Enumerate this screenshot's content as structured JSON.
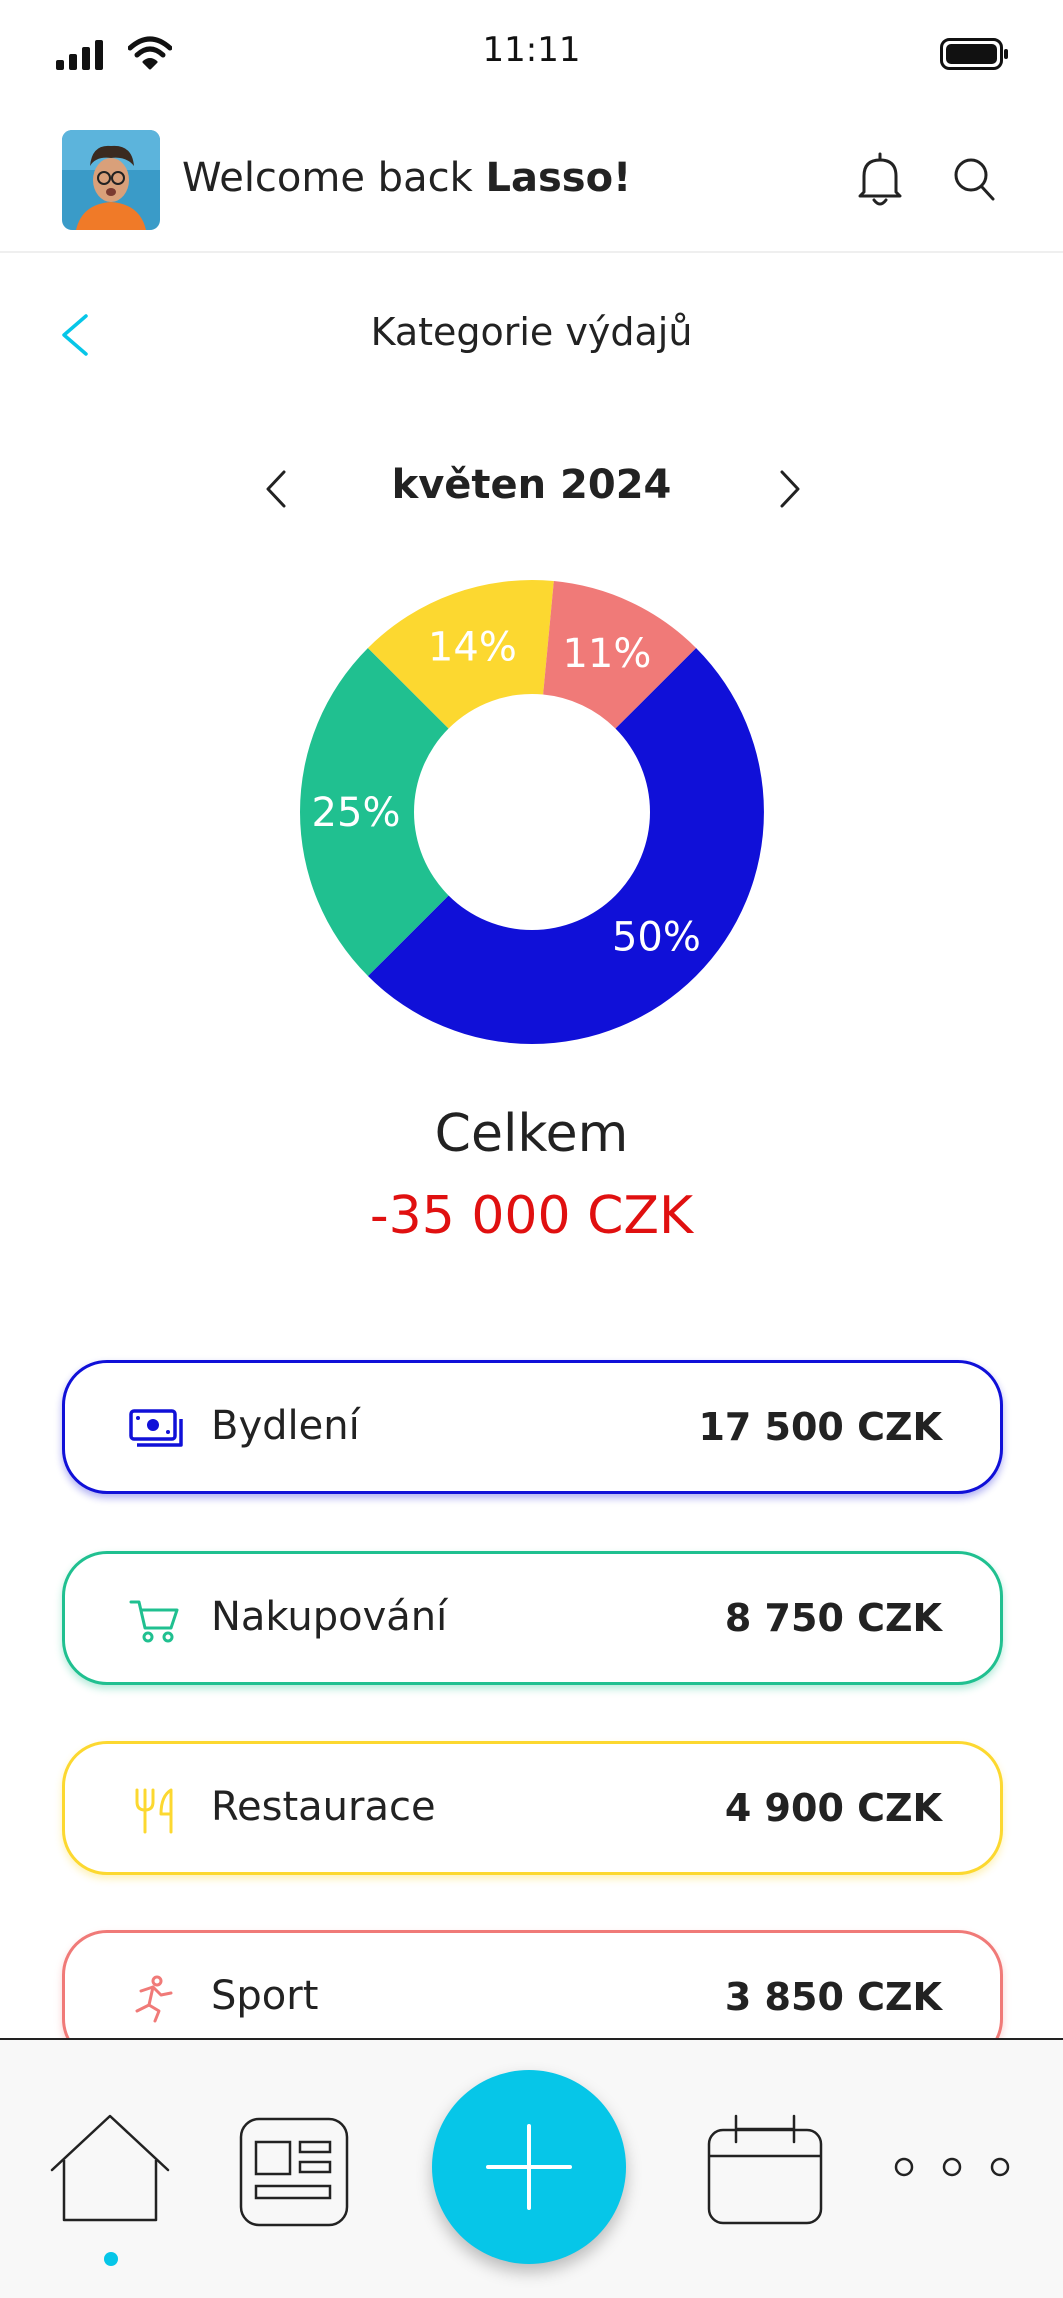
{
  "status_bar": {
    "time": "11:11"
  },
  "header": {
    "welcome_prefix": "Welcome back ",
    "user_name": "Lasso!",
    "icons": [
      "bell-icon",
      "search-icon"
    ]
  },
  "page": {
    "title": "Kategorie výdajů",
    "month": "květen 2024"
  },
  "chart_data": {
    "type": "pie",
    "categories": [
      "Bydlení",
      "Nakupování",
      "Restaurace",
      "Sport"
    ],
    "values": [
      50,
      25,
      14,
      11
    ],
    "labels": [
      "50%",
      "25%",
      "14%",
      "11%"
    ],
    "colors": [
      "#1010d8",
      "#20c090",
      "#fcd830",
      "#f07a78"
    ]
  },
  "total": {
    "label": "Celkem",
    "value": "-35 000 CZK"
  },
  "categories": [
    {
      "name": "Bydlení",
      "amount": "17 500 CZK",
      "color": "#1010d8",
      "icon": "money-icon"
    },
    {
      "name": "Nakupování",
      "amount": "8 750 CZK",
      "color": "#20c090",
      "icon": "cart-icon"
    },
    {
      "name": "Restaurace",
      "amount": "4 900 CZK",
      "color": "#fcd830",
      "icon": "fork-knife-icon"
    },
    {
      "name": "Sport",
      "amount": "3 850 CZK",
      "color": "#f07a78",
      "icon": "runner-icon"
    }
  ],
  "bottom_nav": {
    "items": [
      "home-icon",
      "news-icon",
      "plus-icon",
      "calendar-icon",
      "more-icon"
    ],
    "accent": "#06c6e8"
  }
}
